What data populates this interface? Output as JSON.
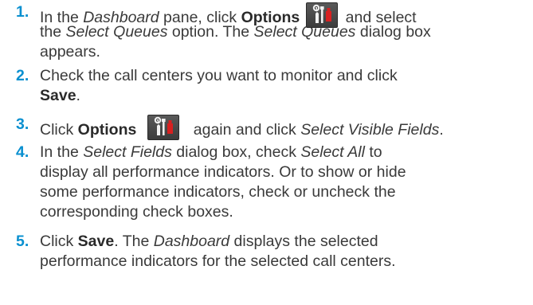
{
  "steps": [
    {
      "num": "1.",
      "l1": [
        "In the ",
        "Dashboard",
        " pane, click ",
        "Options",
        " and select"
      ],
      "l2": [
        "the ",
        "Select Queues",
        " option. The ",
        "Select Queues",
        " dialog box"
      ],
      "l3": "appears."
    },
    {
      "num": "2.",
      "l1": "Check the call centers you want to monitor and click",
      "l2": [
        "Save",
        "."
      ]
    },
    {
      "num": "3.",
      "l1": [
        "Click ",
        "Options",
        " again and click ",
        "Select Visible Fields",
        "."
      ]
    },
    {
      "num": "4.",
      "l1": [
        "In the ",
        "Select Fields",
        " dialog box, check ",
        "Select All",
        " to"
      ],
      "l2": "display all performance indicators. Or to show or hide",
      "l3": "some performance indicators, check or uncheck the",
      "l4": "corresponding check boxes."
    },
    {
      "num": "5.",
      "l1": [
        "Click ",
        "Save",
        ". The ",
        "Dashboard",
        " displays the selected"
      ],
      "l2": "performance indicators for the selected call centers."
    }
  ],
  "icons": {
    "options": "tools-icon"
  },
  "colors": {
    "step_number": "#0a90d0",
    "text": "#3a3a3a",
    "icon_background": "#444444",
    "icon_accent": "#d82020"
  }
}
